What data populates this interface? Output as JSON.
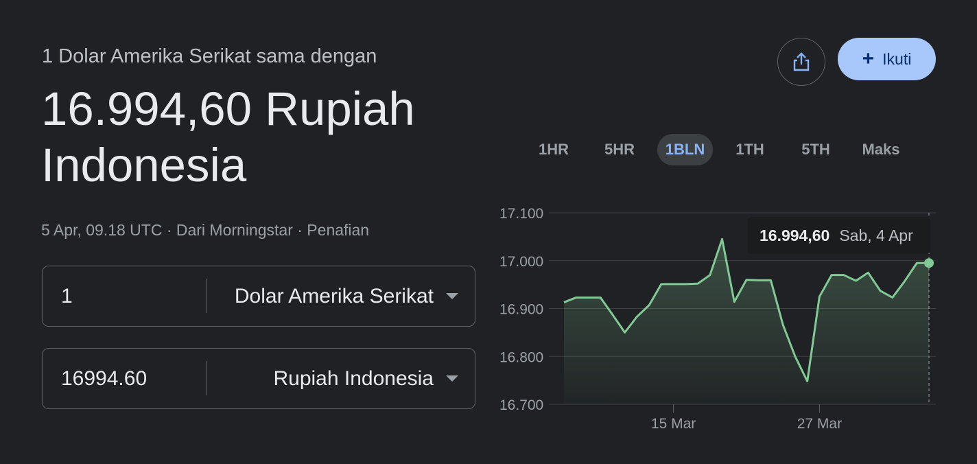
{
  "header": {
    "subtitle": "1 Dolar Amerika Serikat sama dengan",
    "value": "16.994,60 Rupiah Indonesia",
    "meta": "5 Apr, 09.18 UTC · Dari Morningstar · Penafian"
  },
  "converter": {
    "from": {
      "amount": "1",
      "currency": "Dolar Amerika Serikat"
    },
    "to": {
      "amount": "16994.60",
      "currency": "Rupiah Indonesia"
    }
  },
  "actions": {
    "share_icon": "share-icon",
    "follow_label": "Ikuti"
  },
  "ranges": [
    "1HR",
    "5HR",
    "1BLN",
    "1TH",
    "5TH",
    "Maks"
  ],
  "active_range": "1BLN",
  "tooltip": {
    "value": "16.994,60",
    "date": "Sab, 4 Apr"
  },
  "colors": {
    "line": "#81c995",
    "accent": "#a8c7fa",
    "active_tab": "#8ab4f8",
    "background": "#202124"
  },
  "chart_data": {
    "type": "area",
    "ylim": [
      16700,
      17100
    ],
    "y_ticks": [
      17100,
      17000,
      16900,
      16800,
      16700
    ],
    "y_tick_labels": [
      "17.100",
      "17.000",
      "16.900",
      "16.800",
      "16.700"
    ],
    "x_tick_labels": [
      "15 Mar",
      "27 Mar"
    ],
    "x_tick_index": [
      9,
      21
    ],
    "grid": true,
    "series": [
      {
        "values": [
          16913,
          16923,
          16923,
          16923,
          16887,
          16850,
          16883,
          16907,
          16951,
          16951,
          16951,
          16952,
          16970,
          17045,
          16914,
          16960,
          16959,
          16959,
          16866,
          16800,
          16748,
          16925,
          16970,
          16970,
          16958,
          16975,
          16937,
          16923,
          16957,
          16995,
          16995
        ]
      }
    ],
    "highlight_index": 30
  }
}
